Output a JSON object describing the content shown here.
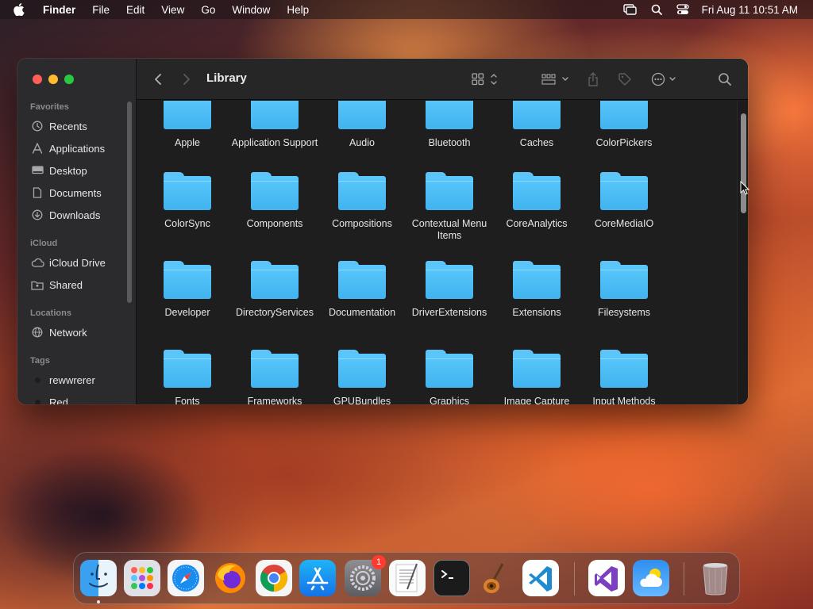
{
  "menubar": {
    "app_name": "Finder",
    "menus": [
      "File",
      "Edit",
      "View",
      "Go",
      "Window",
      "Help"
    ],
    "clock": "Fri Aug 11  10:51 AM",
    "icons": [
      "screen-mirroring-icon",
      "search-icon",
      "control-center-icon"
    ]
  },
  "window": {
    "title": "Library",
    "sidebar": {
      "favorites_header": "Favorites",
      "favorites": [
        {
          "label": "Recents",
          "icon": "clock-icon"
        },
        {
          "label": "Applications",
          "icon": "applications-icon"
        },
        {
          "label": "Desktop",
          "icon": "desktop-icon"
        },
        {
          "label": "Documents",
          "icon": "document-icon"
        },
        {
          "label": "Downloads",
          "icon": "download-icon"
        }
      ],
      "icloud_header": "iCloud",
      "icloud": [
        {
          "label": "iCloud Drive",
          "icon": "cloud-icon"
        },
        {
          "label": "Shared",
          "icon": "shared-folder-icon"
        }
      ],
      "locations_header": "Locations",
      "locations": [
        {
          "label": "Network",
          "icon": "network-icon"
        }
      ],
      "tags_header": "Tags",
      "tags": [
        {
          "label": "rewwrerer"
        },
        {
          "label": "Red"
        }
      ]
    },
    "folders": [
      [
        "Apple",
        "Application Support",
        "Audio",
        "Bluetooth",
        "Caches",
        "ColorPickers"
      ],
      [
        "ColorSync",
        "Components",
        "Compositions",
        "Contextual Menu Items",
        "CoreAnalytics",
        "CoreMediaIO"
      ],
      [
        "Developer",
        "DirectoryServices",
        "Documentation",
        "DriverExtensions",
        "Extensions",
        "Filesystems"
      ],
      [
        "Fonts",
        "Frameworks",
        "GPUBundles",
        "Graphics",
        "Image Capture",
        "Input Methods"
      ]
    ],
    "scroll_position": 0.12
  },
  "dock": {
    "apps": [
      {
        "name": "Finder",
        "icon": "finder-icon",
        "running": true
      },
      {
        "name": "Launchpad",
        "icon": "launchpad-icon"
      },
      {
        "name": "Safari",
        "icon": "safari-icon"
      },
      {
        "name": "Firefox",
        "icon": "firefox-icon"
      },
      {
        "name": "Chrome",
        "icon": "chrome-icon"
      },
      {
        "name": "App Store",
        "icon": "app-store-icon"
      },
      {
        "name": "System Settings",
        "icon": "settings-icon",
        "badge": "1"
      },
      {
        "name": "TextEdit",
        "icon": "textedit-icon"
      },
      {
        "name": "Terminal",
        "icon": "terminal-icon"
      },
      {
        "name": "GarageBand",
        "icon": "garageband-icon"
      },
      {
        "name": "Visual Studio Code",
        "icon": "vscode-icon"
      },
      {
        "name": "Visual Studio",
        "icon": "visual-studio-icon"
      },
      {
        "name": "Weather",
        "icon": "weather-icon"
      },
      {
        "name": "Trash",
        "icon": "trash-icon"
      }
    ]
  }
}
